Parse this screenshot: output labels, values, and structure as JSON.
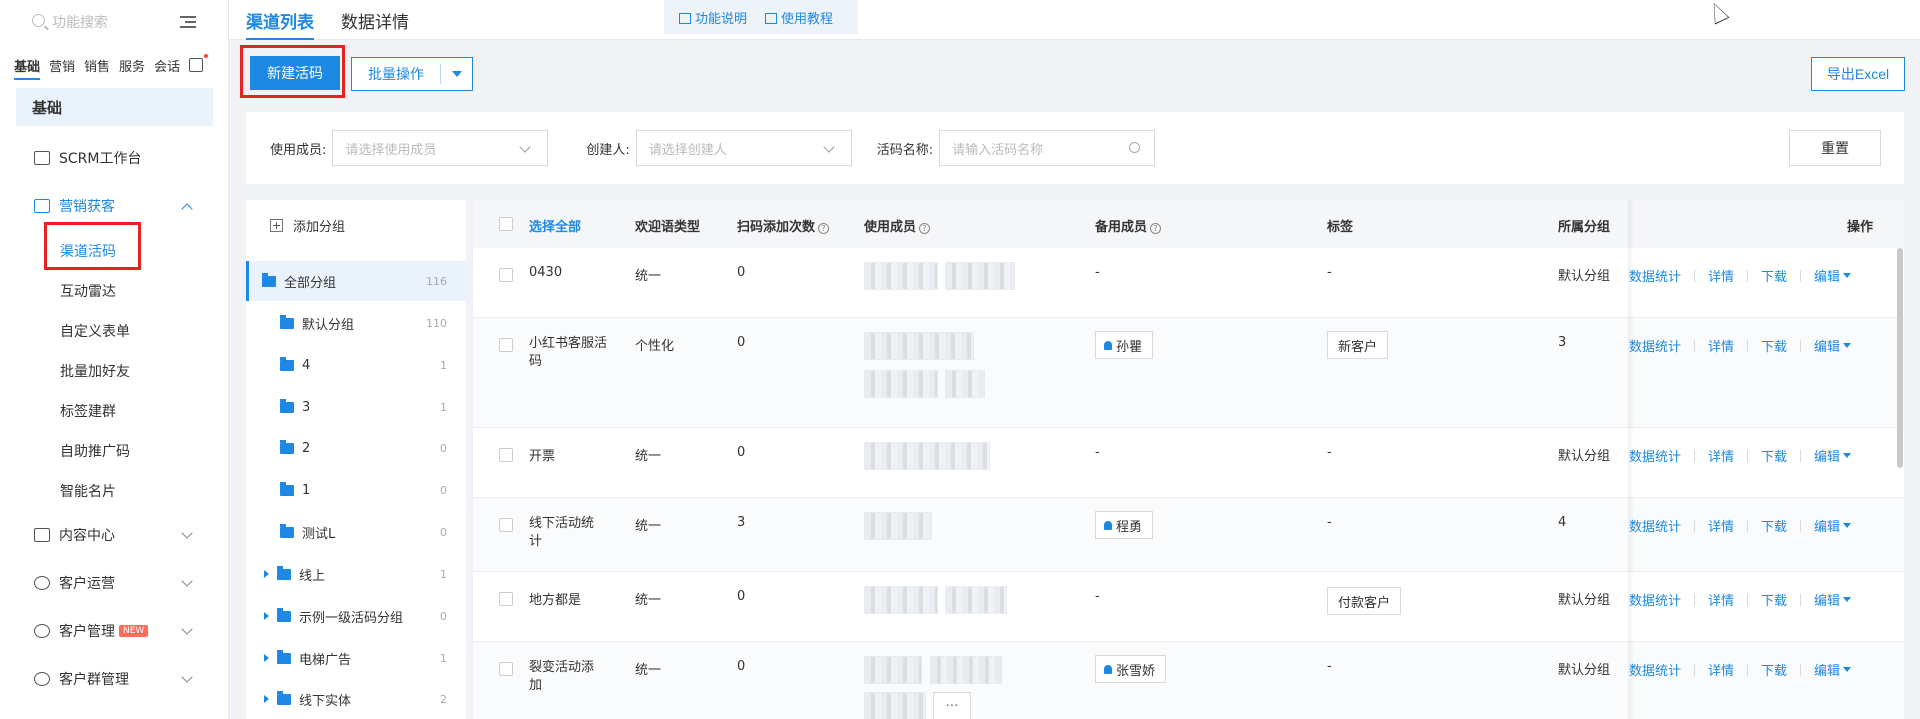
{
  "sidebar": {
    "search_placeholder": "功能搜索",
    "tabs": [
      "基础",
      "营销",
      "销售",
      "服务",
      "会话"
    ],
    "section_title": "基础",
    "items": [
      {
        "label": "SCRM工作台"
      },
      {
        "label": "营销获客"
      },
      {
        "label": "内容中心"
      },
      {
        "label": "客户运营"
      },
      {
        "label": "客户管理",
        "badge": "NEW"
      },
      {
        "label": "客户群管理"
      }
    ],
    "sub_items": [
      "渠道活码",
      "互动雷达",
      "自定义表单",
      "批量加好友",
      "标签建群",
      "自助推广码",
      "智能名片"
    ]
  },
  "topbar": {
    "tabs": [
      "渠道列表",
      "数据详情"
    ],
    "help": [
      "功能说明",
      "使用教程"
    ]
  },
  "actions": {
    "new_label": "新建活码",
    "batch_label": "批量操作",
    "export_label": "导出Excel"
  },
  "filter": {
    "member_label": "使用成员:",
    "member_placeholder": "请选择使用成员",
    "creator_label": "创建人:",
    "creator_placeholder": "请选择创建人",
    "name_label": "活码名称:",
    "name_placeholder": "请输入活码名称",
    "reset_label": "重置"
  },
  "groups": {
    "add_label": "添加分组",
    "items": [
      {
        "name": "全部分组",
        "count": "116"
      },
      {
        "name": "默认分组",
        "count": "110"
      },
      {
        "name": "4",
        "count": "1"
      },
      {
        "name": "3",
        "count": "1"
      },
      {
        "name": "2",
        "count": "0"
      },
      {
        "name": "1",
        "count": "0"
      },
      {
        "name": "测试L",
        "count": "0"
      },
      {
        "name": "线上",
        "count": "1"
      },
      {
        "name": "示例一级活码分组",
        "count": "0"
      },
      {
        "name": "电梯广告",
        "count": "1"
      },
      {
        "name": "线下实体",
        "count": "2"
      }
    ]
  },
  "table": {
    "headers": {
      "select_all": "选择全部",
      "type": "欢迎语类型",
      "scans": "扫码添加次数",
      "members": "使用成员",
      "backup": "备用成员",
      "tags": "标签",
      "group": "所属分组",
      "ops": "操作"
    },
    "ops": [
      "数据统计",
      "详情",
      "下载",
      "编辑"
    ],
    "rows": [
      {
        "name": "0430",
        "type": "统一",
        "scans": "0",
        "backup": "-",
        "tag": "-",
        "group": "默认分组"
      },
      {
        "name": "小红书客服活码",
        "type": "个性化",
        "scans": "0",
        "backup": "孙瞿",
        "tag": "新客户",
        "group": "3"
      },
      {
        "name": "开票",
        "type": "统一",
        "scans": "0",
        "backup": "-",
        "tag": "-",
        "group": "默认分组"
      },
      {
        "name": "线下活动统计",
        "type": "统一",
        "scans": "3",
        "backup": "程勇",
        "tag": "-",
        "group": "4"
      },
      {
        "name": "地方都是",
        "type": "统一",
        "scans": "0",
        "backup": "-",
        "tag": "付款客户",
        "group": "默认分组"
      },
      {
        "name": "裂变活动添加",
        "type": "统一",
        "scans": "0",
        "backup": "张雪娇",
        "tag": "-",
        "group": "默认分组"
      }
    ],
    "more": "..."
  },
  "colors": {
    "accent": "#1e88e5",
    "highlight": "#e52323"
  }
}
